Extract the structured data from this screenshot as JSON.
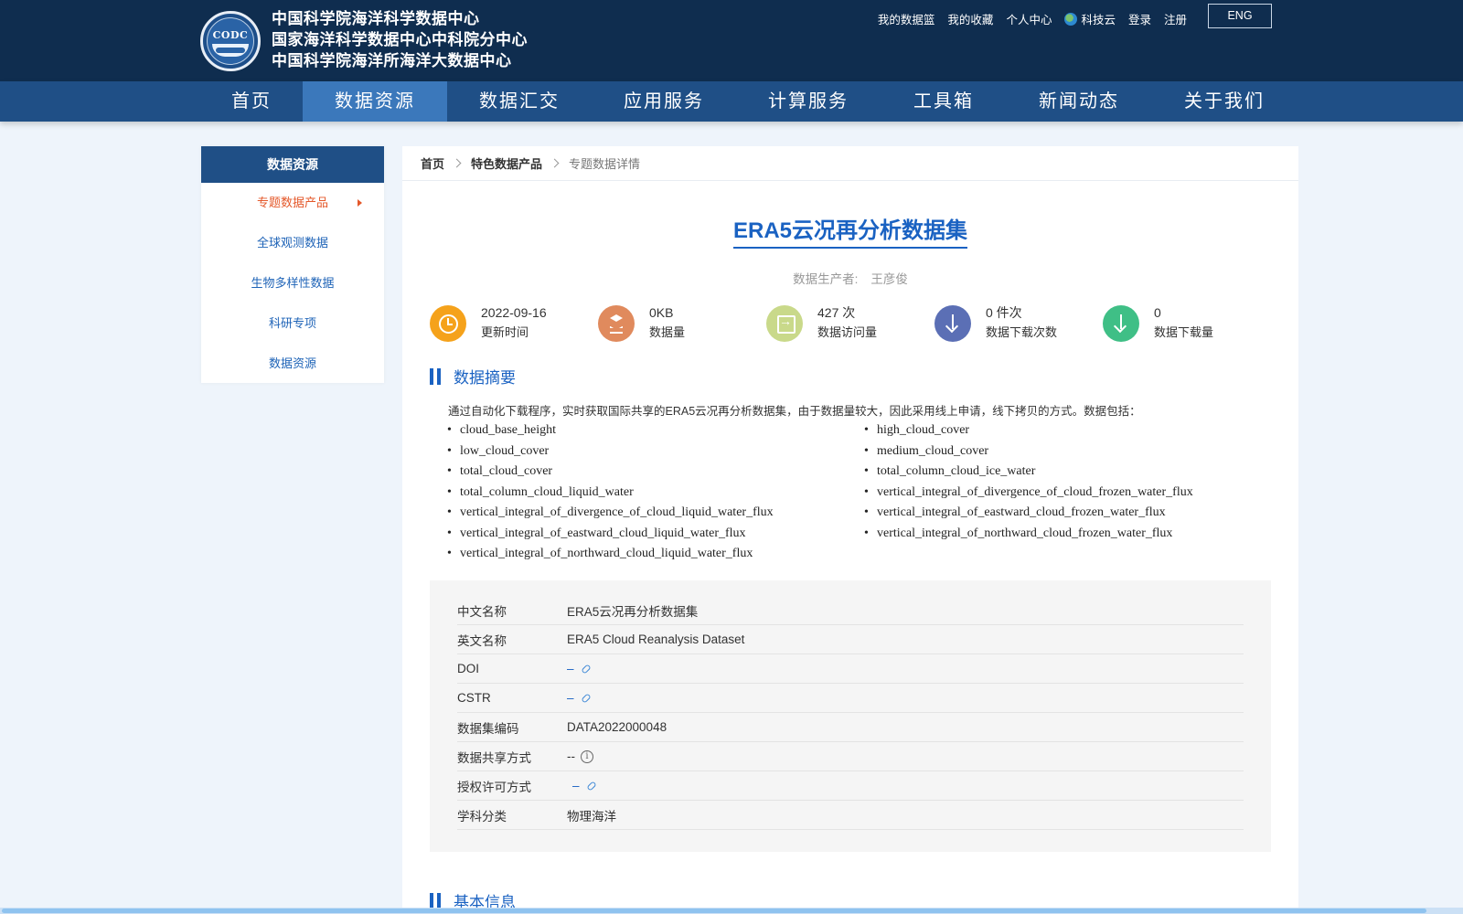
{
  "header": {
    "logo_text": "CODC",
    "names": [
      "中国科学院海洋科学数据中心",
      "国家海洋科学数据中心中科院分中心",
      "中国科学院海洋所海洋大数据中心"
    ],
    "top_links": [
      "我的数据篮",
      "我的收藏",
      "个人中心",
      "科技云",
      "登录",
      "注册"
    ],
    "lang_button": "ENG"
  },
  "nav": {
    "items": [
      "首页",
      "数据资源",
      "数据汇交",
      "应用服务",
      "计算服务",
      "工具箱",
      "新闻动态",
      "关于我们"
    ],
    "active": "数据资源"
  },
  "sidebar": {
    "title": "数据资源",
    "items": [
      "专题数据产品",
      "全球观测数据",
      "生物多样性数据",
      "科研专项",
      "数据资源"
    ]
  },
  "breadcrumb": {
    "home": "首页",
    "section": "特色数据产品",
    "current": "专题数据详情"
  },
  "dataset": {
    "title": "ERA5云况再分析数据集",
    "producer_label": "数据生产者:",
    "producer": "王彦俊"
  },
  "stats": [
    {
      "value": "2022-09-16",
      "label": "更新时间",
      "color": "#f5a21b"
    },
    {
      "value": "0KB",
      "label": "数据量",
      "color": "#e08a5d"
    },
    {
      "value": "427 次",
      "label": "数据访问量",
      "color": "#c9d98a"
    },
    {
      "value": "0 件次",
      "label": "数据下载次数",
      "color": "#5b6fb5"
    },
    {
      "value": "0",
      "label": "数据下载量",
      "color": "#3fbf86"
    }
  ],
  "summary": {
    "title": "数据摘要",
    "intro": "通过自动化下载程序，实时获取国际共享的ERA5云况再分析数据集，由于数据量较大，因此采用线上申请，线下拷贝的方式。数据包括：",
    "params": [
      "cloud_base_height",
      "high_cloud_cover",
      "low_cloud_cover",
      "medium_cloud_cover",
      "total_cloud_cover",
      "total_column_cloud_ice_water",
      "total_column_cloud_liquid_water",
      "vertical_integral_of_divergence_of_cloud_frozen_water_flux",
      "vertical_integral_of_divergence_of_cloud_liquid_water_flux",
      "vertical_integral_of_eastward_cloud_frozen_water_flux",
      "vertical_integral_of_eastward_cloud_liquid_water_flux",
      "vertical_integral_of_northward_cloud_frozen_water_flux",
      "vertical_integral_of_northward_cloud_liquid_water_flux"
    ]
  },
  "meta": [
    {
      "key": "中文名称",
      "value": "ERA5云况再分析数据集",
      "type": "text"
    },
    {
      "key": "英文名称",
      "value": "ERA5 Cloud Reanalysis Dataset",
      "type": "text"
    },
    {
      "key": "DOI",
      "value": "–",
      "type": "link"
    },
    {
      "key": "CSTR",
      "value": "–",
      "type": "link"
    },
    {
      "key": "数据集编码",
      "value": "DATA2022000048",
      "type": "text"
    },
    {
      "key": "数据共享方式",
      "value": "--",
      "type": "info"
    },
    {
      "key": "授权许可方式",
      "value": "–",
      "type": "link"
    },
    {
      "key": "学科分类",
      "value": "物理海洋",
      "type": "text"
    }
  ],
  "basic_info": {
    "title": "基本信息"
  }
}
